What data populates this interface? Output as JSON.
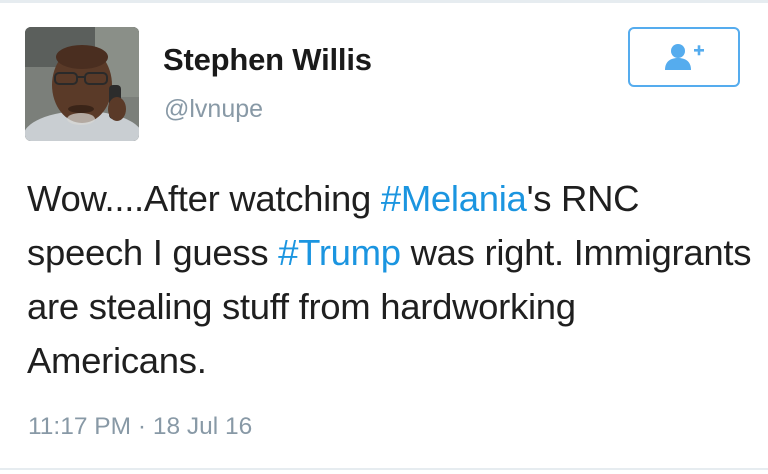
{
  "user": {
    "name": "Stephen Willis",
    "handle": "@lvnupe",
    "avatar_icon": "profile-photo"
  },
  "follow_button": {
    "icon": "add-user-icon",
    "color": "#55acee"
  },
  "tweet": {
    "segments": [
      {
        "text": "Wow....After watching ",
        "type": "text"
      },
      {
        "text": "#Melania",
        "type": "hashtag"
      },
      {
        "text": "'s RNC speech I guess ",
        "type": "text"
      },
      {
        "text": "#Trump",
        "type": "hashtag"
      },
      {
        "text": " was right. Immigrants are stealing stuff from hardworking Americans.",
        "type": "text"
      }
    ],
    "time": "11:17 PM",
    "separator": "·",
    "date": "18 Jul 16"
  },
  "colors": {
    "hashtag": "#1b95e0",
    "secondary_text": "#8899a6",
    "border": "#e6ecf0"
  }
}
